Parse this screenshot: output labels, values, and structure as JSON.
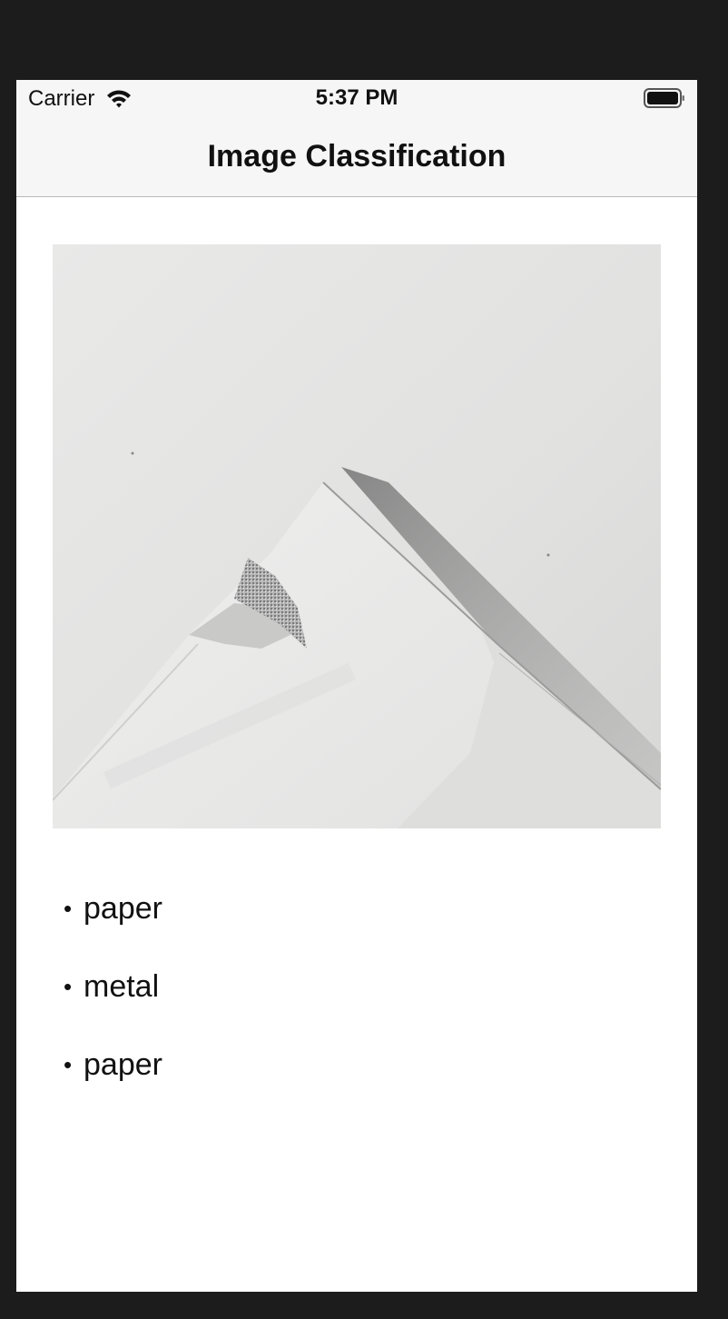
{
  "status_bar": {
    "carrier": "Carrier",
    "time": "5:37 PM",
    "icons": [
      "wifi-icon",
      "battery-icon"
    ]
  },
  "nav": {
    "title": "Image Classification"
  },
  "image": {
    "subject": "folded-paper-with-foil-corner"
  },
  "results": [
    {
      "label": "paper"
    },
    {
      "label": "metal"
    },
    {
      "label": "paper"
    }
  ],
  "colors": {
    "background": "#1c1c1c",
    "screen": "#ffffff",
    "nav_bar": "#f6f6f7",
    "text": "#111111"
  }
}
